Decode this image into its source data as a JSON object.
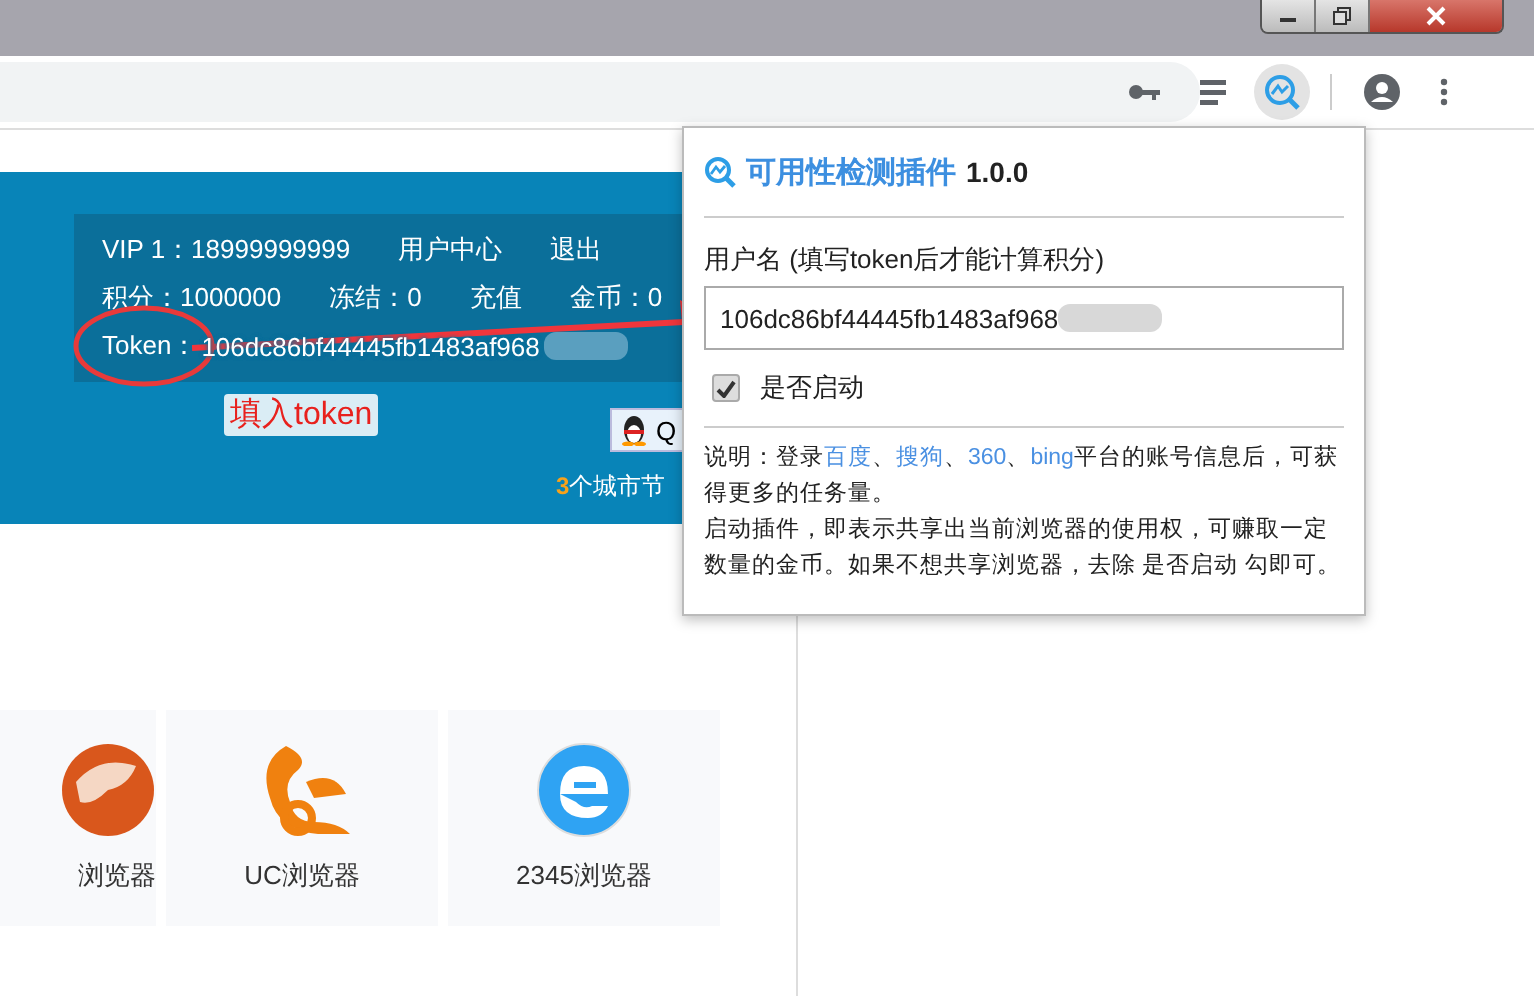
{
  "banner": {
    "account_row": [
      "VIP 1：18999999999",
      "用户中心",
      "退出"
    ],
    "points_row": [
      "积分：1000000",
      "冻结：0",
      "充值",
      "金币：0"
    ],
    "token_label": "Token：",
    "token_value": "106dc86bf44445fb1483af968",
    "annotation": "填入token",
    "qq_button": "Q",
    "cities_count": "3",
    "cities_text": "个城市节"
  },
  "browsers": [
    {
      "kind": "cheetah",
      "label": "浏览器"
    },
    {
      "kind": "uc",
      "label": "UC浏览器"
    },
    {
      "kind": "ie",
      "label": "2345浏览器"
    }
  ],
  "popup": {
    "title": "可用性检测插件",
    "version": "1.0.0",
    "field_label": "用户名 (填写token后才能计算积分)",
    "field_value": "106dc86bf44445fb1483af968",
    "enable_label": "是否启动",
    "enable_checked": true,
    "note": [
      [
        {
          "kind": "text",
          "text": "说明：登录"
        },
        {
          "kind": "link",
          "text": "百度"
        },
        {
          "kind": "text",
          "text": "、"
        },
        {
          "kind": "link",
          "text": "搜狗"
        },
        {
          "kind": "text",
          "text": "、"
        },
        {
          "kind": "link",
          "text": "360"
        },
        {
          "kind": "text",
          "text": "、"
        },
        {
          "kind": "link",
          "text": "bing"
        },
        {
          "kind": "text",
          "text": "平台的账号信息后，可获得更多的任务量。"
        }
      ],
      [
        {
          "kind": "text",
          "text": "启动插件，即表示共享出当前浏览器的使用权，可赚取一定数量的金币。如果不想共享浏览器，去除 是否启动 勾即可。"
        }
      ]
    ]
  }
}
